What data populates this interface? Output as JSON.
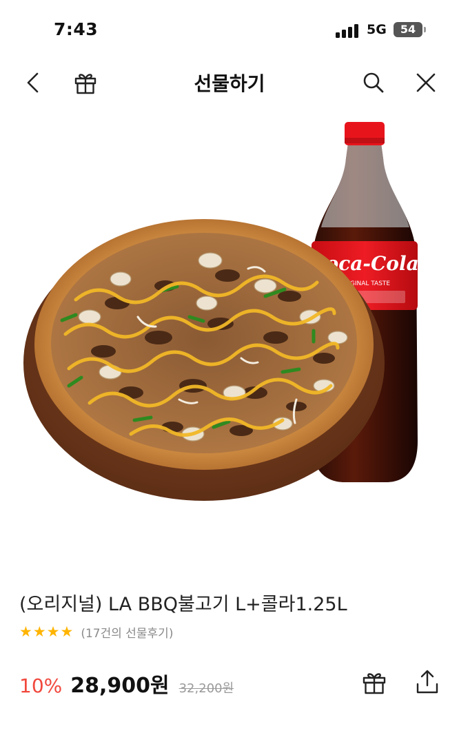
{
  "status_bar": {
    "time": "7:43",
    "network": "5G",
    "battery": "54"
  },
  "nav": {
    "title": "선물하기",
    "icons": [
      "back-icon",
      "gift-icon",
      "search-icon",
      "close-icon"
    ]
  },
  "product": {
    "image_alt": "pizza and coca-cola bottle",
    "bottle_brand": "Coca-Cola",
    "bottle_subtitle": "ORIGINAL TASTE",
    "name": "(오리지널) LA BBQ불고기 L+콜라1.25L",
    "rating": {
      "stars": "★★★★",
      "review_text": "(17건의 선물후기)"
    },
    "price": {
      "discount": "10%",
      "sale_price": "28,900원",
      "original_price": "32,200원"
    }
  },
  "actions": {
    "icons": [
      "gift-icon",
      "share-icon"
    ]
  },
  "colors": {
    "discount": "#f1483d",
    "star": "#ffb400",
    "cola_red": "#e8141c"
  }
}
